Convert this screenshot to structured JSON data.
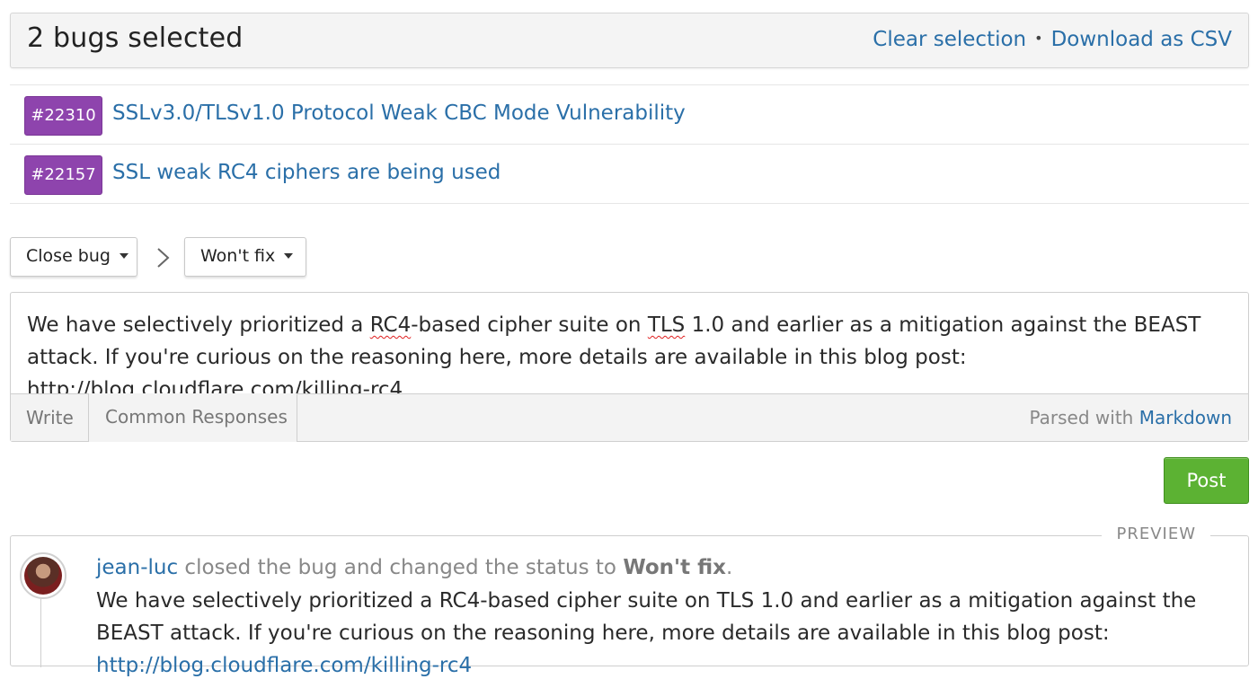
{
  "header": {
    "title": "2 bugs selected",
    "clear_selection": "Clear selection",
    "separator": "•",
    "download_csv": "Download as CSV"
  },
  "bugs": [
    {
      "id": "#22310",
      "title": "SSLv3.0/TLSv1.0 Protocol Weak CBC Mode Vulnerability",
      "badge_color": "#8e44ad"
    },
    {
      "id": "#22157",
      "title": "SSL weak RC4 ciphers are being used",
      "badge_color": "#8e44ad"
    }
  ],
  "actions": {
    "action_dropdown": "Close bug",
    "status_dropdown": "Won't fix"
  },
  "editor": {
    "text_parts": [
      "We have selectively prioritized a ",
      "RC4",
      "-based cipher suite on ",
      "TLS",
      " 1.0 and earlier as a mitigation against the BEAST attack. If you're curious on the reasoning here, more details are available in this blog post: ",
      "http",
      "://",
      "blog.cloudflare.com",
      "/killing-",
      "rc4"
    ],
    "tab_write": "Write",
    "tab_common_responses": "Common Responses",
    "parsed_with": "Parsed with",
    "markdown_link": "Markdown"
  },
  "post_button": "Post",
  "preview": {
    "label": "PREVIEW",
    "user": "jean-luc",
    "action_text": " closed the bug and changed the status to ",
    "status": "Won't fix",
    "period": ".",
    "body": "We have selectively prioritized a RC4-based cipher suite on TLS 1.0 and earlier as a mitigation against the BEAST attack. If you're curious on the reasoning here, more details are available in this blog post: ",
    "link": "http://blog.cloudflare.com/killing-rc4"
  },
  "colors": {
    "link": "#2a6fa8",
    "badge": "#8e44ad",
    "post_button": "#5cb233"
  },
  "icons": {
    "caret": "caret-down-icon",
    "chevron": "chevron-right-icon",
    "avatar": "user-avatar"
  }
}
